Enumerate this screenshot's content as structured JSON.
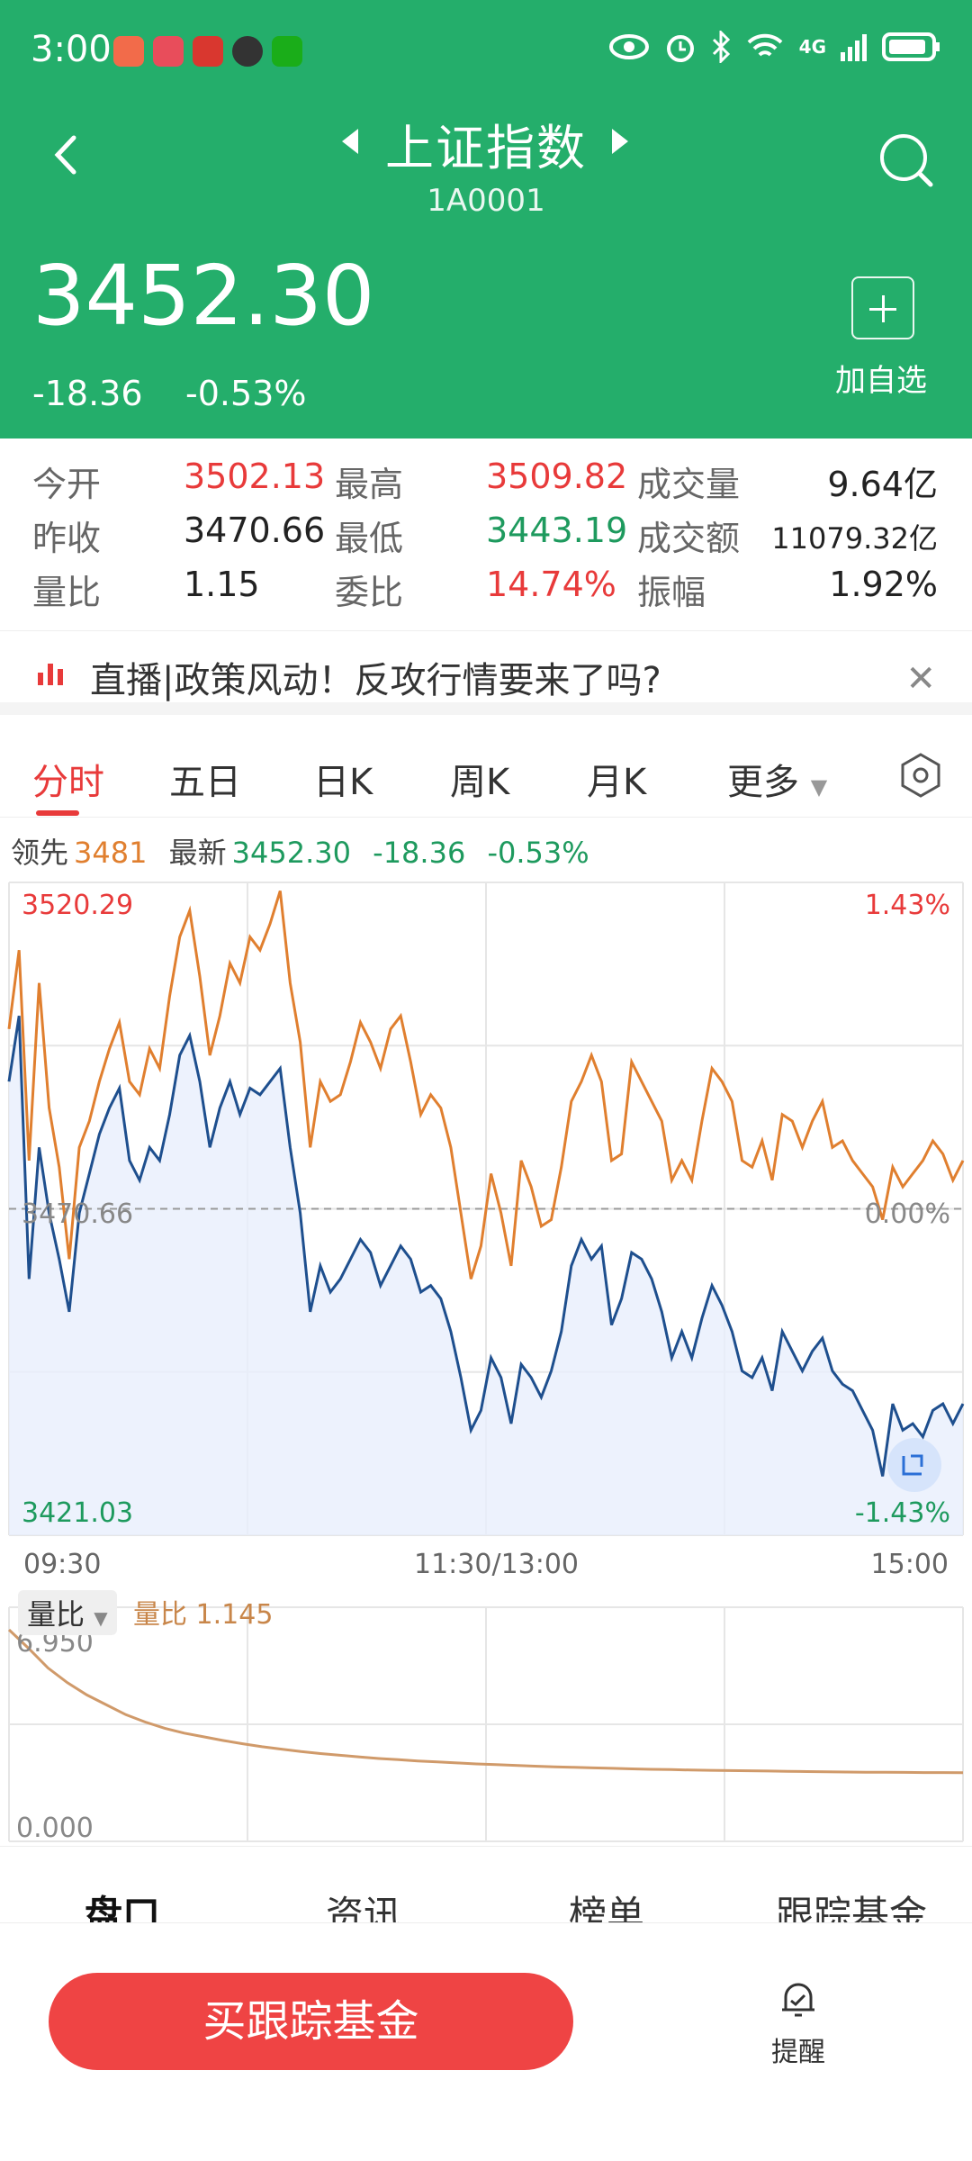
{
  "status": {
    "time": "3:00",
    "network": "4G"
  },
  "header": {
    "title": "上证指数",
    "code": "1A0001"
  },
  "quote": {
    "price": "3452.30",
    "change": "-18.36",
    "percent": "-0.53%",
    "add_label": "加自选"
  },
  "stats": [
    [
      {
        "label": "今开",
        "value": "3502.13",
        "color": "red"
      },
      {
        "label": "最高",
        "value": "3509.82",
        "color": "red"
      },
      {
        "label": "成交量",
        "value": "9.64亿",
        "color": "blk"
      }
    ],
    [
      {
        "label": "昨收",
        "value": "3470.66",
        "color": "blk"
      },
      {
        "label": "最低",
        "value": "3443.19",
        "color": "grn"
      },
      {
        "label": "成交额",
        "value": "11079.32亿",
        "color": "blk"
      }
    ],
    [
      {
        "label": "量比",
        "value": "1.15",
        "color": "blk"
      },
      {
        "label": "委比",
        "value": "14.74%",
        "color": "red"
      },
      {
        "label": "振幅",
        "value": "1.92%",
        "color": "blk"
      }
    ]
  ],
  "news": {
    "text": "直播|政策风动！反攻行情要来了吗?"
  },
  "tabs": [
    "分时",
    "五日",
    "日K",
    "周K",
    "月K",
    "更多"
  ],
  "legend": {
    "lead_label": "领先",
    "lead_value": "3481",
    "latest_label": "最新",
    "latest_value": "3452.30",
    "change": "-18.36",
    "percent": "-0.53%"
  },
  "chart_data": [
    {
      "type": "line",
      "y_top": "3520.29",
      "y_mid": "3470.66",
      "y_bottom": "3421.03",
      "pct_top": "1.43%",
      "pct_mid": "0.00%",
      "pct_bottom": "-1.43%",
      "ylim": [
        3421.03,
        3520.29
      ],
      "x_labels": [
        "09:30",
        "11:30/13:00",
        "15:00"
      ],
      "series": [
        {
          "color": "#e07f2f",
          "values": [
            3498,
            3510,
            3478,
            3505,
            3486,
            3477,
            3463,
            3480,
            3484,
            3490,
            3495,
            3499,
            3490,
            3488,
            3495,
            3492,
            3503,
            3512,
            3516,
            3506,
            3494,
            3500,
            3508,
            3505,
            3512,
            3510,
            3514,
            3519,
            3505,
            3496,
            3480,
            3490,
            3487,
            3488,
            3493,
            3499,
            3496,
            3492,
            3498,
            3500,
            3493,
            3485,
            3488,
            3486,
            3480,
            3470,
            3460,
            3465,
            3476,
            3470,
            3462,
            3478,
            3474,
            3468,
            3469,
            3477,
            3487,
            3490,
            3494,
            3490,
            3478,
            3479,
            3493,
            3490,
            3487,
            3484,
            3475,
            3478,
            3475,
            3484,
            3492,
            3490,
            3487,
            3478,
            3477,
            3481,
            3475,
            3485,
            3484,
            3480,
            3484,
            3487,
            3480,
            3481,
            3478,
            3476,
            3474,
            3469,
            3477,
            3474,
            3476,
            3478,
            3481,
            3479,
            3475,
            3478
          ]
        },
        {
          "color": "#1e4f8e",
          "values": [
            3490,
            3500,
            3460,
            3480,
            3470,
            3463,
            3455,
            3470,
            3476,
            3482,
            3486,
            3489,
            3478,
            3475,
            3480,
            3478,
            3485,
            3494,
            3497,
            3490,
            3480,
            3486,
            3490,
            3485,
            3489,
            3488,
            3490,
            3492,
            3480,
            3470,
            3455,
            3462,
            3458,
            3460,
            3463,
            3466,
            3464,
            3459,
            3462,
            3465,
            3463,
            3458,
            3459,
            3457,
            3452,
            3445,
            3437,
            3440,
            3448,
            3445,
            3438,
            3447,
            3445,
            3442,
            3446,
            3452,
            3462,
            3466,
            3463,
            3465,
            3453,
            3457,
            3464,
            3463,
            3460,
            3455,
            3448,
            3452,
            3448,
            3454,
            3459,
            3456,
            3452,
            3446,
            3445,
            3448,
            3443,
            3452,
            3449,
            3446,
            3449,
            3451,
            3446,
            3444,
            3443,
            3440,
            3437,
            3430,
            3441,
            3437,
            3438,
            3436,
            3440,
            3441,
            3438,
            3441
          ]
        }
      ]
    },
    {
      "type": "line",
      "title": "量比",
      "value_label": "量比 1.145",
      "y_top": "6.950",
      "y_bottom": "0.000",
      "ylim": [
        0,
        6.95
      ],
      "series": [
        {
          "color": "#d09a6a",
          "values": [
            6.95,
            6.2,
            5.4,
            4.8,
            4.3,
            3.9,
            3.5,
            3.2,
            2.95,
            2.75,
            2.6,
            2.45,
            2.32,
            2.2,
            2.1,
            2.0,
            1.92,
            1.85,
            1.78,
            1.72,
            1.67,
            1.62,
            1.58,
            1.54,
            1.5,
            1.47,
            1.44,
            1.41,
            1.38,
            1.36,
            1.34,
            1.32,
            1.3,
            1.28,
            1.27,
            1.25,
            1.24,
            1.23,
            1.22,
            1.21,
            1.2,
            1.19,
            1.18,
            1.17,
            1.165,
            1.16,
            1.155,
            1.15,
            1.148,
            1.145
          ]
        }
      ]
    }
  ],
  "bottom_tabs": [
    "盘口",
    "资讯",
    "榜单",
    "跟踪基金"
  ],
  "buy_button": "买跟踪基金",
  "remind_label": "提醒"
}
